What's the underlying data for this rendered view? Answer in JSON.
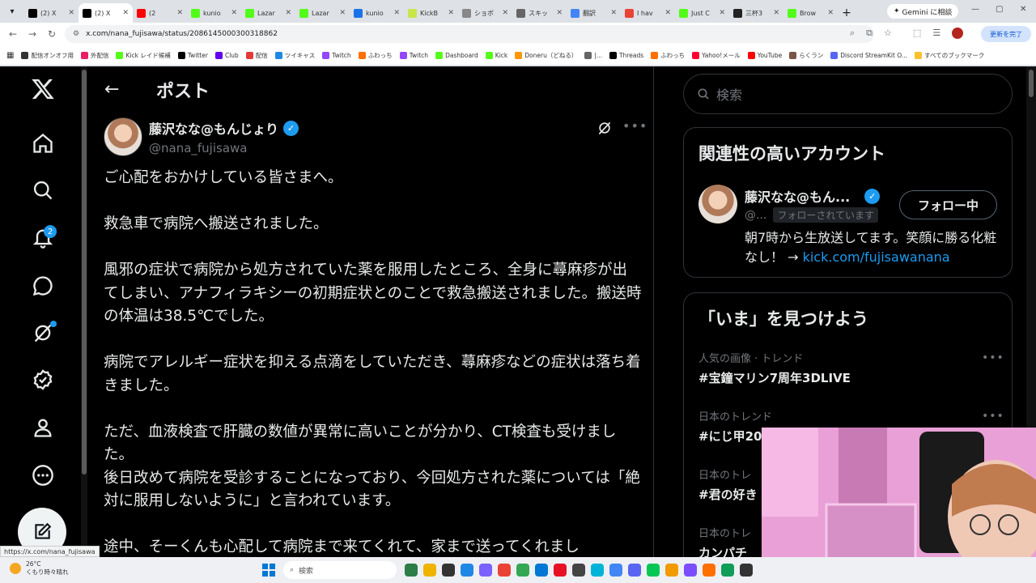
{
  "browser": {
    "tabs": [
      {
        "label": "(2) X",
        "fav": "x-icon",
        "color": "#000000"
      },
      {
        "label": "(2) X",
        "fav": "x-icon",
        "color": "#000000",
        "active": true
      },
      {
        "label": "(2",
        "fav": "youtube-icon",
        "color": "#ff0000"
      },
      {
        "label": "kunio",
        "fav": "kick-icon",
        "color": "#53fc18"
      },
      {
        "label": "Lazar",
        "fav": "kick-icon",
        "color": "#53fc18"
      },
      {
        "label": "Lazar",
        "fav": "kick-icon",
        "color": "#53fc18"
      },
      {
        "label": "kunio",
        "fav": "generic-icon",
        "color": "#1a73e8"
      },
      {
        "label": "KickB",
        "fav": "generic-icon",
        "color": "#c8e64a"
      },
      {
        "label": "ショボ",
        "fav": "generic-icon",
        "color": "#888888"
      },
      {
        "label": "スキッ",
        "fav": "generic-icon",
        "color": "#666666"
      },
      {
        "label": "翻訳",
        "fav": "google-icon",
        "color": "#4285f4"
      },
      {
        "label": "I hav",
        "fav": "gmail-icon",
        "color": "#ea4335"
      },
      {
        "label": "Just C",
        "fav": "kick-icon",
        "color": "#53fc18"
      },
      {
        "label": "三杯3",
        "fav": "generic-icon",
        "color": "#222222"
      },
      {
        "label": "Brow",
        "fav": "kick-icon",
        "color": "#53fc18"
      }
    ],
    "gemini_label": "Gemini に相談",
    "url": "x.com/nana_fujisawa/status/2086145000300318862",
    "update_label": "更新を完了",
    "bookmarks": [
      {
        "label": "配信オンオフ用",
        "color": "#333"
      },
      {
        "label": "外配信",
        "color": "#e91e63"
      },
      {
        "label": "Kick レイド候補",
        "color": "#53fc18"
      },
      {
        "label": "Twitter",
        "color": "#000"
      },
      {
        "label": "Club",
        "color": "#6200ea"
      },
      {
        "label": "配信",
        "color": "#e53935"
      },
      {
        "label": "ツイキャス",
        "color": "#1e88e5"
      },
      {
        "label": "Twitch",
        "color": "#9146ff"
      },
      {
        "label": "ふわっち",
        "color": "#ff6f00"
      },
      {
        "label": "Twitch",
        "color": "#9146ff"
      },
      {
        "label": "Dashboard",
        "color": "#53fc18"
      },
      {
        "label": "Kick",
        "color": "#53fc18"
      },
      {
        "label": "Doneru（どねる）",
        "color": "#ff9800"
      },
      {
        "label": "|...",
        "color": "#666"
      },
      {
        "label": "Threads",
        "color": "#000"
      },
      {
        "label": "ふわっち",
        "color": "#ff6f00"
      },
      {
        "label": "Yahoo!メール",
        "color": "#ff0033"
      },
      {
        "label": "YouTube",
        "color": "#ff0000"
      },
      {
        "label": "らくラン",
        "color": "#795548"
      },
      {
        "label": "Discord StreamKit O...",
        "color": "#5865f2"
      },
      {
        "label": "すべてのブックマーク",
        "color": "#fbc02d"
      }
    ]
  },
  "leftnav": {
    "notifications_badge": "2"
  },
  "header": {
    "title": "ポスト"
  },
  "post": {
    "author_name": "藤沢なな@もんじょり",
    "handle": "@nana_fujisawa",
    "paragraphs": [
      [
        "ご心配をおかけしている皆さまへ。"
      ],
      [
        "救急車で病院へ搬送されました。"
      ],
      [
        "風邪の症状で病院から処方されていた薬を服用したところ、全身に蕁麻疹が出てしまい、アナフィラキシーの初期症状とのことで救急搬送されました。搬送時の体温は38.5℃でした。"
      ],
      [
        "病院でアレルギー症状を抑える点滴をしていただき、蕁麻疹などの症状は落ち着きました。"
      ],
      [
        "ただ、血液検査で肝臓の数値が異常に高いことが分かり、CT検査も受けました。",
        "後日改めて病院を受診することになっており、今回処方された薬については「絶対に服用しないように」と言われています。"
      ],
      [
        "途中、そーくんも心配して病院まで来てくれて、家まで送ってくれまし"
      ]
    ]
  },
  "sidebar": {
    "search_placeholder": "検索",
    "related_title": "関連性の高いアカウント",
    "related_name": "藤沢なな@もん...",
    "related_handle": "@...",
    "follows_you": "フォローされています",
    "follow_button": "フォロー中",
    "bio_text": "朝7時から生放送してます。笑顔に勝る化粧なし！ → ",
    "bio_link": "kick.com/fujisawanana",
    "trends_title": "「いま」を見つけよう",
    "trends": [
      {
        "meta": "人気の画像 · トレンド",
        "tag": "#宝鐘マリン7周年3DLIVE"
      },
      {
        "meta": "日本のトレンド",
        "tag": "#にじ甲20"
      },
      {
        "meta": "日本のトレ",
        "tag": "#君の好き"
      },
      {
        "meta": "日本のトレ",
        "tag": "カンパチ"
      }
    ]
  },
  "status_url": "https://x.com/nana_fujisawa",
  "taskbar": {
    "temp": "26°C",
    "weather": "くもり時々晴れ",
    "search": "検索",
    "app_colors": [
      "#2d7d46",
      "#f0b400",
      "#333",
      "#1e88e5",
      "#7b61ff",
      "#ea4335",
      "#34a853",
      "#0078d4",
      "#e81123",
      "#444",
      "#00b4d8",
      "#4285f4",
      "#5865f2",
      "#06c755",
      "#f29b00",
      "#7c4dff",
      "#ff6f00",
      "#0f9d58",
      "#333"
    ]
  }
}
